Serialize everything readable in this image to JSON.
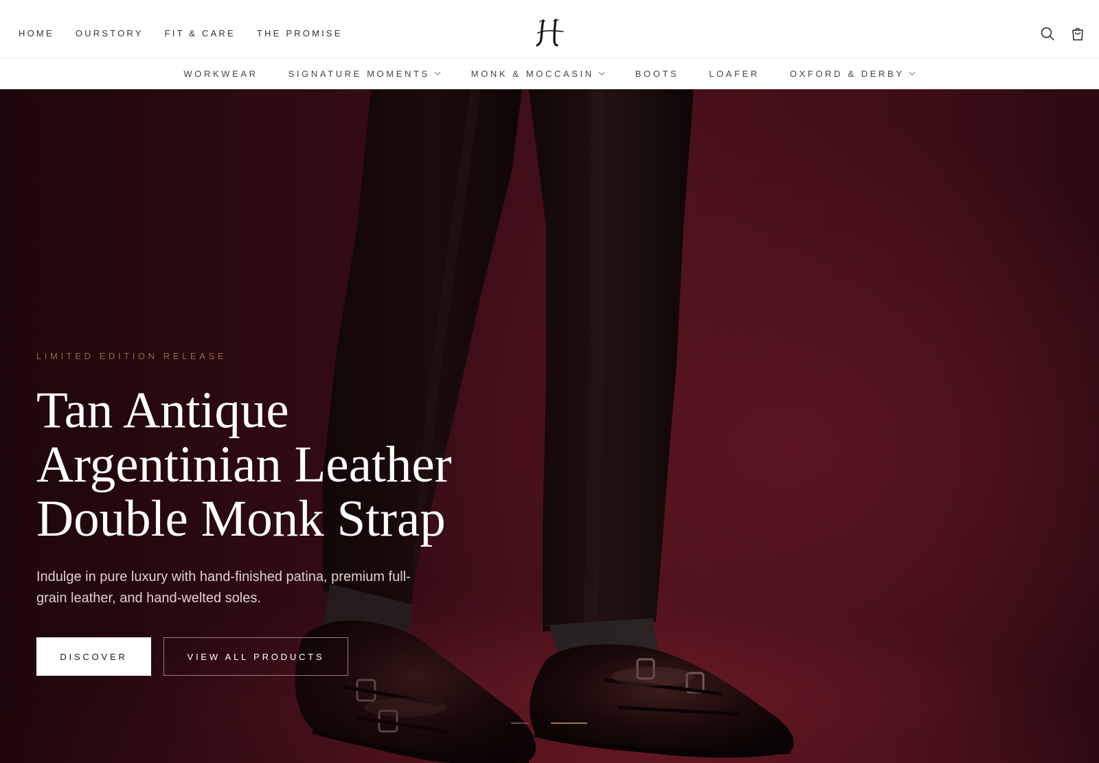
{
  "header": {
    "primary_nav": [
      "HOME",
      "OURSTORY",
      "FIT & CARE",
      "THE PROMISE"
    ],
    "logo_alt": "H",
    "icons": {
      "search": "search-icon",
      "cart": "shopping-bag-icon"
    }
  },
  "category_nav": [
    {
      "label": "WORKWEAR",
      "has_dropdown": false
    },
    {
      "label": "SIGNATURE MOMENTS",
      "has_dropdown": true
    },
    {
      "label": "MONK & MOCCASIN",
      "has_dropdown": true
    },
    {
      "label": "BOOTS",
      "has_dropdown": false
    },
    {
      "label": "LOAFER",
      "has_dropdown": false
    },
    {
      "label": "OXFORD & DERBY",
      "has_dropdown": true
    }
  ],
  "hero": {
    "eyebrow": "LIMITED EDITION RELEASE",
    "headline_lines": [
      "Tan Antique",
      "Argentinian Leather",
      "Double Monk Strap"
    ],
    "subcopy": "Indulge in pure luxury with hand-finished patina, premium full-grain leather, and hand-welted soles.",
    "primary_cta": "DISCOVER",
    "secondary_cta": "VIEW ALL PRODUCTS",
    "slides_total": 2,
    "active_slide": 2
  },
  "colors": {
    "hero_background": "#4b111b",
    "accent_gold": "#8d6a3e",
    "text_dark": "#1a1a1a"
  }
}
